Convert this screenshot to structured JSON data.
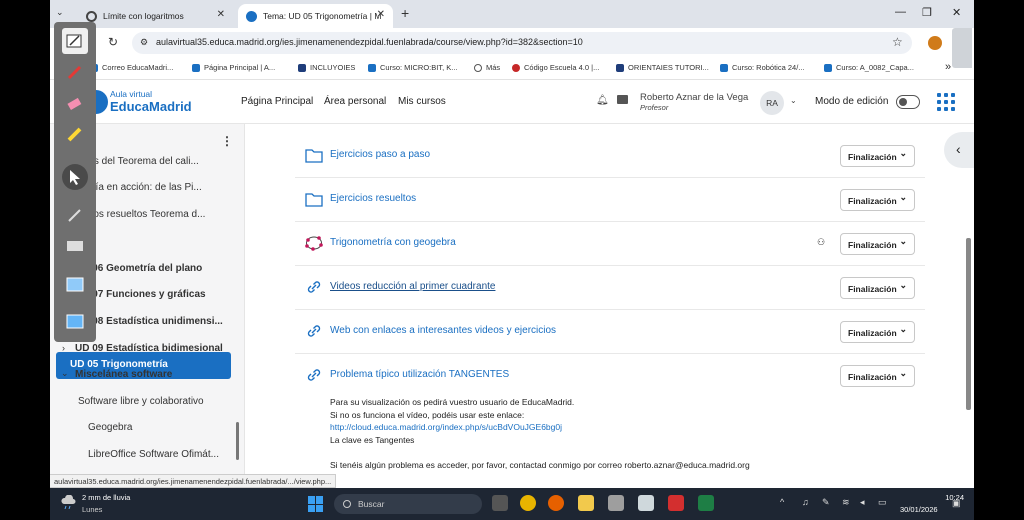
{
  "tabs": [
    {
      "title": "Límite con logaritmos"
    },
    {
      "title": "Tema: UD 05 Trigonometría | M"
    }
  ],
  "address": {
    "url": "aulavirtual35.educa.madrid.org/ies.jimenamenendezpidal.fuenlabrada/course/view.php?id=382&section=10"
  },
  "bookmarks": [
    {
      "label": "Correo EducaMadri..."
    },
    {
      "label": "Página Principal | A..."
    },
    {
      "label": "INCLUYOIES"
    },
    {
      "label": "Curso: MICRO:BIT, K..."
    },
    {
      "label": "Más"
    },
    {
      "label": "Código Escuela 4.0 |..."
    },
    {
      "label": "ORIENTAIES TUTORI..."
    },
    {
      "label": "Curso: Robótica 24/..."
    },
    {
      "label": "Curso: A_0082_Capa..."
    }
  ],
  "header": {
    "logo_line1": "Aula virtual",
    "logo_line2": "EducaMadrid",
    "nav": [
      "Página Principal",
      "Área personal",
      "Mis cursos"
    ],
    "user_name": "Roberto Aznar de la Vega",
    "user_role": "Profesor",
    "avatar": "RA",
    "edit_mode": "Modo de edición"
  },
  "drawer": {
    "items": [
      {
        "label": "ciones del Teorema del cali..."
      },
      {
        "label": "ometría en acción: de las Pi..."
      },
      {
        "label": "ercicios resueltos Teorema d..."
      },
      {
        "label": "UD 05 Trigonometría"
      },
      {
        "label": "UD 06 Geometría del plano"
      },
      {
        "label": "UD 07 Funciones y gráficas"
      },
      {
        "label": "UD 08 Estadística unidimensi..."
      },
      {
        "label": "UD 09 Estadística bidimesional"
      },
      {
        "label": "Miscelánea software"
      },
      {
        "label": "Software libre y colaborativo"
      },
      {
        "label": "Geogebra"
      },
      {
        "label": "LibreOffice Software Ofimát..."
      }
    ]
  },
  "activities": [
    {
      "label": "Ejercicios paso a paso",
      "icon": "folder-icon",
      "button": "Finalización"
    },
    {
      "label": "Ejercicios resueltos",
      "icon": "folder-icon",
      "button": "Finalización"
    },
    {
      "label": "Trigonometría con geogebra",
      "icon": "geogebra-icon",
      "button": "Finalización"
    },
    {
      "label": "Videos reducción al primer cuadrante",
      "icon": "link-icon",
      "button": "Finalización"
    },
    {
      "label": "Web con enlaces a interesantes videos y ejercicios",
      "icon": "link-icon",
      "button": "Finalización"
    },
    {
      "label": "Problema típico utilización TANGENTES",
      "icon": "link-icon",
      "button": "Finalización"
    }
  ],
  "description": {
    "line1": "Para su visualización os pedirá vuestro usuario de EducaMadrid.",
    "line2": "Si no os funciona el vídeo, podéis usar este enlace:",
    "link": "http://cloud.educa.madrid.org/index.php/s/ucBdVOuJGE6bg0j",
    "line3": "La clave es Tangentes",
    "line4": "Si tenéis algún problema es acceder, por favor, contactad conmigo por correo roberto.aznar@educa.madrid.org"
  },
  "status_url": "aulavirtual35.educa.madrid.org/ies.jimenamenendezpidal.fuenlabrada/.../view.php...",
  "taskbar": {
    "weather_line1": "2 mm de lluvia",
    "weather_line2": "Lunes",
    "search": "Buscar",
    "time": "10:24",
    "date": "30/01/2026"
  },
  "colors": {
    "accent": "#1a6fc2",
    "taskbar": "#1e2633"
  }
}
